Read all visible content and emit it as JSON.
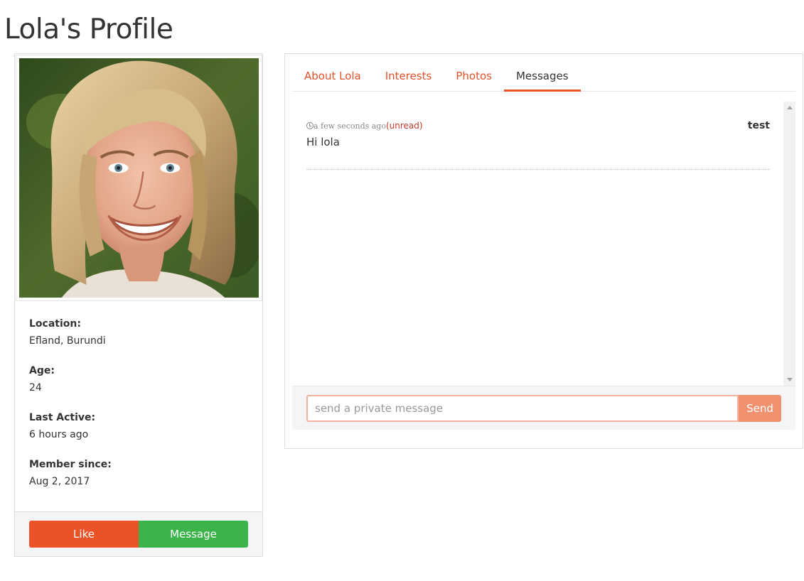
{
  "page": {
    "title": "Lola's Profile"
  },
  "profile": {
    "photo_alt": "Lola",
    "details": [
      {
        "label": "Location:",
        "value": "Efland, Burundi"
      },
      {
        "label": "Age:",
        "value": "24"
      },
      {
        "label": "Last Active:",
        "value": "6 hours ago"
      },
      {
        "label": "Member since:",
        "value": "Aug 2, 2017"
      }
    ],
    "actions": {
      "like_label": "Like",
      "message_label": "Message"
    }
  },
  "tabs": [
    {
      "label": "About Lola",
      "active": false
    },
    {
      "label": "Interests",
      "active": false
    },
    {
      "label": "Photos",
      "active": false
    },
    {
      "label": "Messages",
      "active": true
    }
  ],
  "messages": [
    {
      "time": "a few seconds ago",
      "status": "(unread)",
      "author": "test",
      "text": "Hi lola"
    }
  ],
  "compose": {
    "placeholder": "send a private message",
    "value": "",
    "send_label": "Send"
  },
  "colors": {
    "accent": "#ea5328",
    "like_button": "#ea5328",
    "message_button": "#3cb44b",
    "send_button": "#f0926f",
    "unread_text": "#c0392b"
  },
  "icons": {
    "message_time": "clock-icon"
  }
}
